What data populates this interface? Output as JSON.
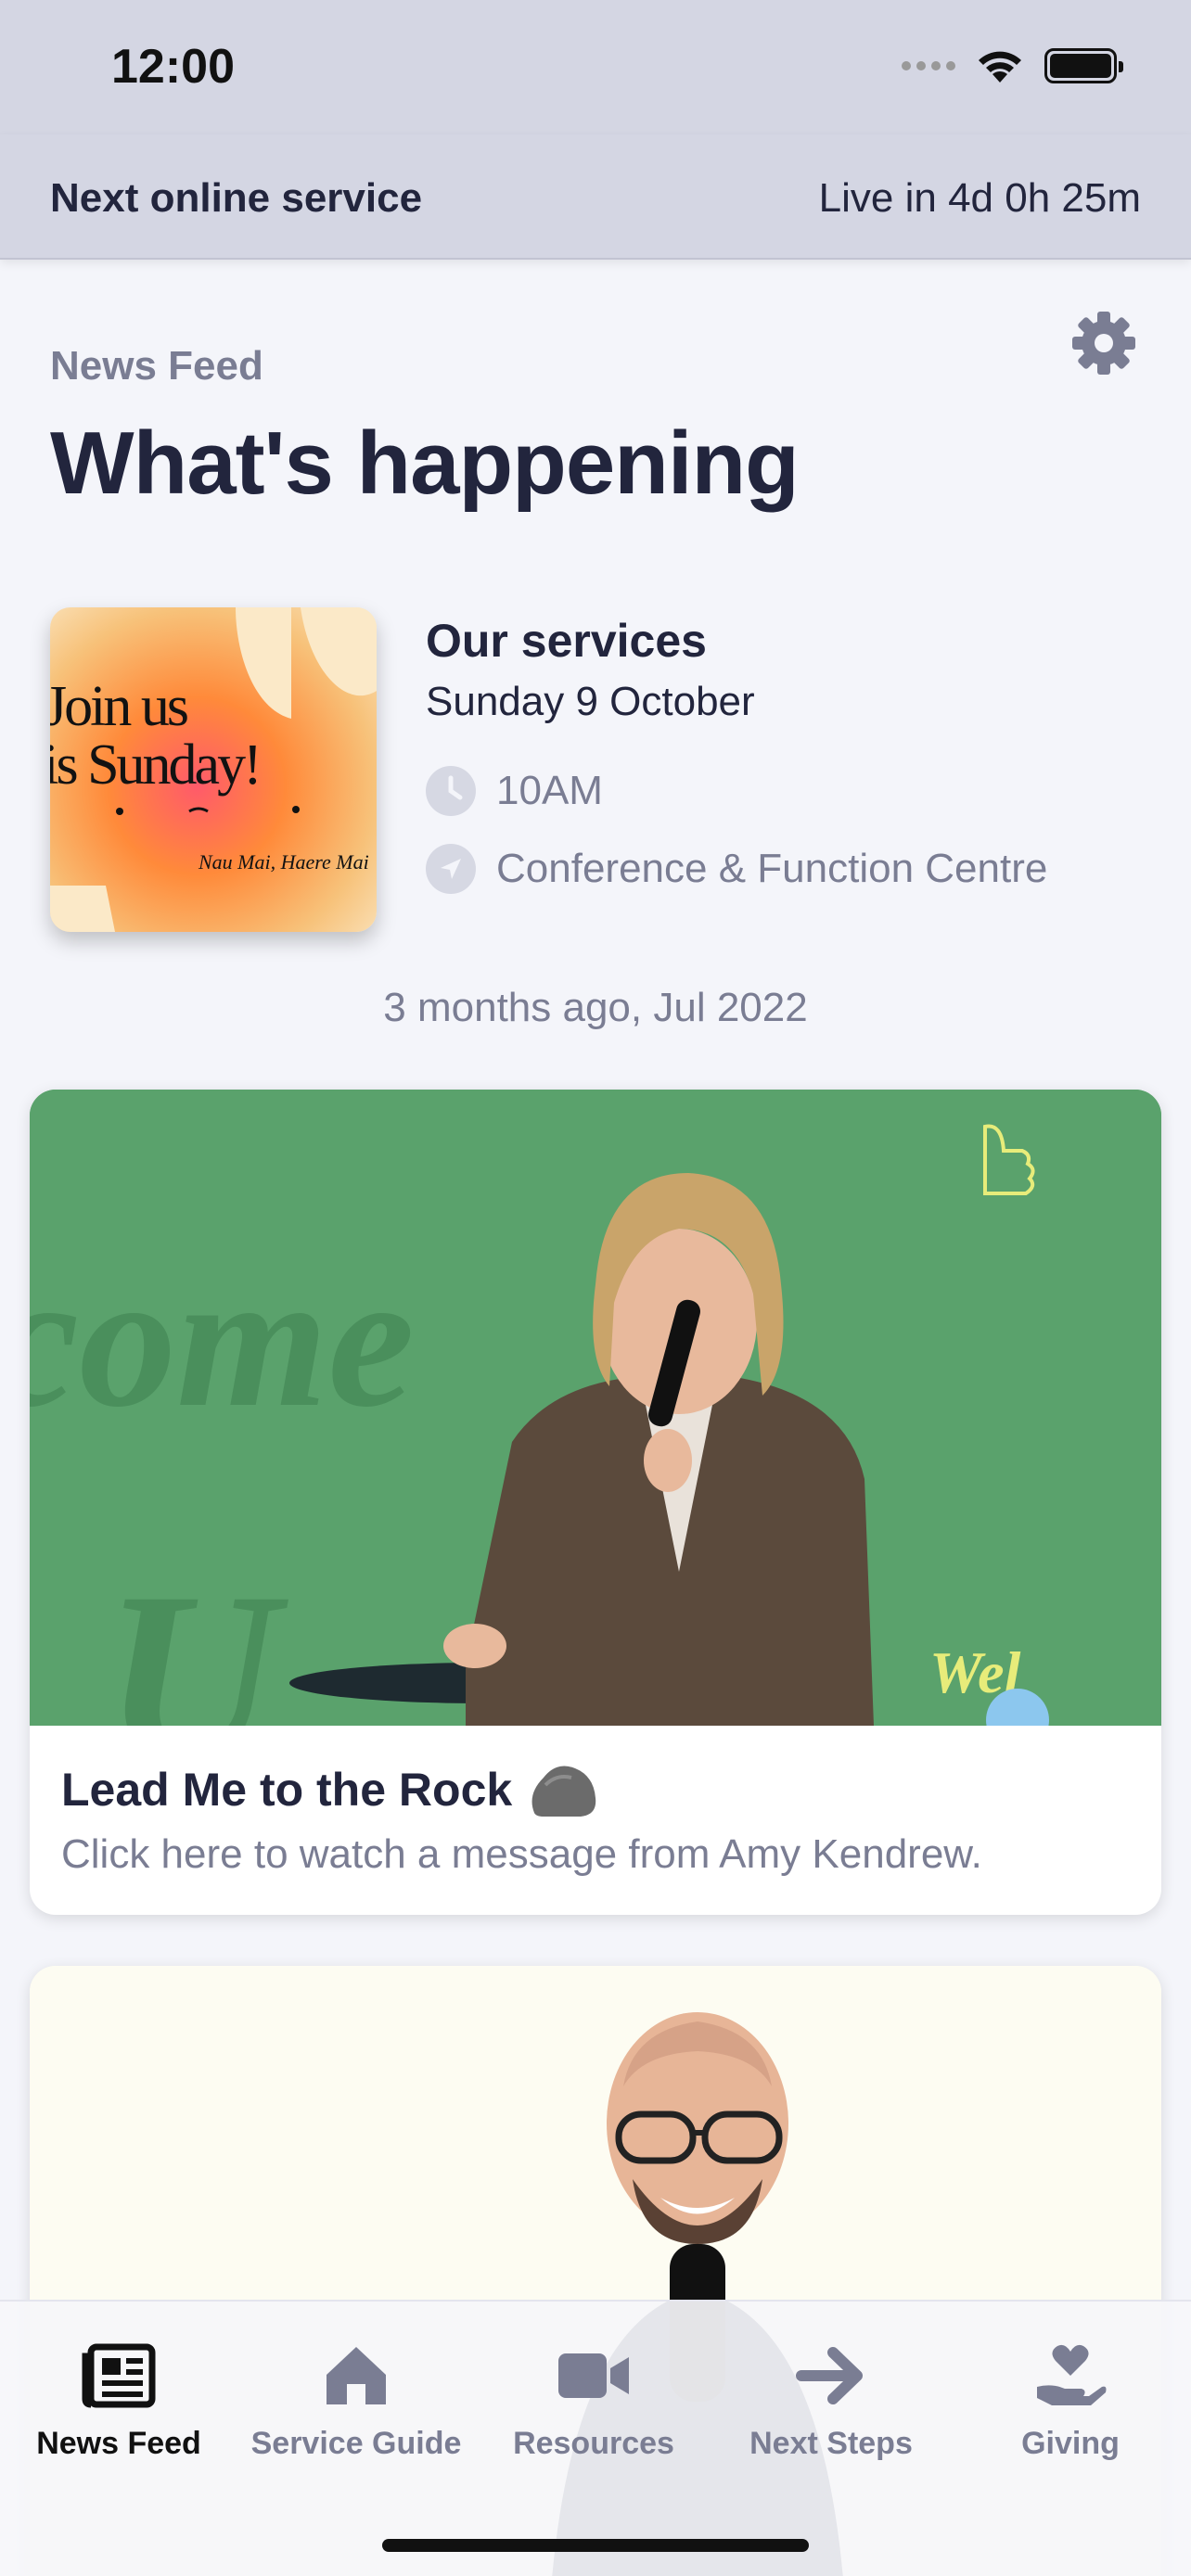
{
  "status_bar": {
    "time": "12:00"
  },
  "next_service": {
    "label": "Next online service",
    "countdown": "Live in 4d 0h 25m"
  },
  "header": {
    "subtitle": "News Feed",
    "title": "What's happening",
    "settings_icon": "gear-icon"
  },
  "event": {
    "thumbnail_text": {
      "line1": "Join us",
      "line2": "this Sunday!",
      "line3": "Nau Mai, Haere Mai"
    },
    "title": "Our services",
    "date": "Sunday 9 October",
    "time": "10AM",
    "location": "Conference & Function Centre"
  },
  "feed": {
    "posted": "3 months ago, Jul 2022",
    "cards": [
      {
        "title": "Lead Me to the Rock",
        "description": "Click here to watch a message from Amy Kendrew."
      }
    ]
  },
  "tabs": [
    {
      "label": "News Feed",
      "icon": "newspaper-icon",
      "active": true
    },
    {
      "label": "Service Guide",
      "icon": "home-icon",
      "active": false
    },
    {
      "label": "Resources",
      "icon": "video-icon",
      "active": false
    },
    {
      "label": "Next Steps",
      "icon": "arrow-right-icon",
      "active": false
    },
    {
      "label": "Giving",
      "icon": "heart-hand-icon",
      "active": false
    }
  ],
  "colors": {
    "header_bg": "#d4d6e3",
    "page_bg": "#f4f5fa",
    "text_primary": "#22253d",
    "text_muted": "#7a7d93",
    "card_green": "#5aa26c"
  }
}
